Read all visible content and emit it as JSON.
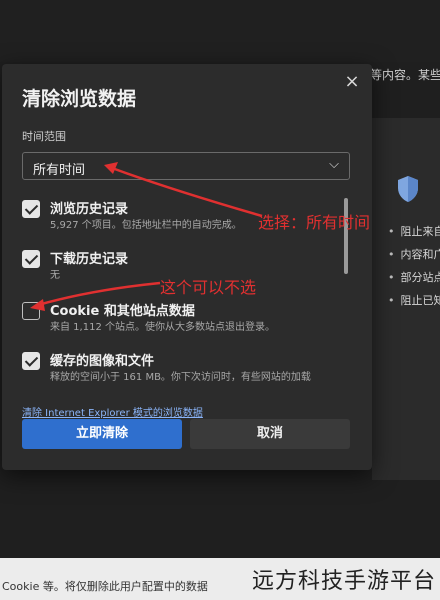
{
  "background": {
    "right_text": "等内容。某些",
    "list": [
      "阻止来自",
      "内容和广",
      "部分站点",
      "阻止已知"
    ],
    "bottom_text": "Cookie 等。将仅删除此用户配置中的数据",
    "watermark": "远方科技手游平台"
  },
  "dialog": {
    "title": "清除浏览数据",
    "close_icon": "×",
    "time_range_label": "时间范围",
    "time_range_value": "所有时间",
    "chevron": "⌵",
    "items": [
      {
        "name": "浏览历史记录",
        "desc": "5,927 个项目。包括地址栏中的自动完成。",
        "checked": true
      },
      {
        "name": "下载历史记录",
        "desc": "无",
        "checked": true
      },
      {
        "name": "Cookie 和其他站点数据",
        "desc": "来自 1,112 个站点。使你从大多数站点退出登录。",
        "checked": false
      },
      {
        "name": "缓存的图像和文件",
        "desc": "释放的空间小于 161 MB。你下次访问时，有些网站的加载",
        "checked": true
      }
    ],
    "ie_link": "清除 Internet Explorer 模式的浏览数据",
    "clear_button": "立即清除",
    "cancel_button": "取消"
  },
  "annotations": {
    "select_all_time": "选择：所有时间",
    "optional": "这个可以不选"
  },
  "colors": {
    "accent": "#2f6fce",
    "annotation": "#e03030"
  }
}
